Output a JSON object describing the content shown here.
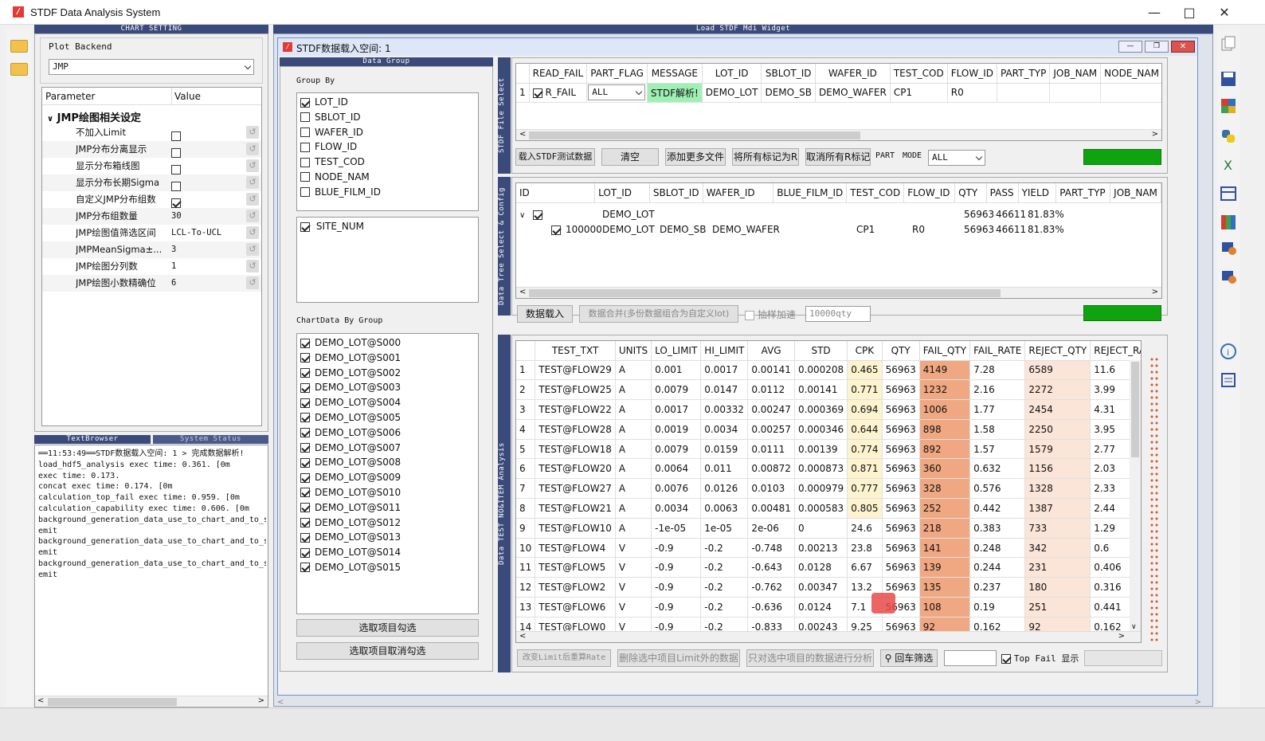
{
  "window": {
    "title": "STDF Data Analysis System",
    "app_icon": "stdf-logo-icon"
  },
  "chart_setting": {
    "header": "CHART SETTING",
    "plot_backend_label": "Plot Backend",
    "plot_backend_value": "JMP",
    "param_col": "Parameter",
    "value_col": "Value",
    "group_title": "JMP绘图相关设定",
    "params": [
      {
        "name": "不加入Limit",
        "type": "check",
        "checked": false
      },
      {
        "name": "JMP分布分离显示",
        "type": "check",
        "checked": false
      },
      {
        "name": "显示分布箱线图",
        "type": "check",
        "checked": false
      },
      {
        "name": "显示分布长期Sigma",
        "type": "check",
        "checked": false
      },
      {
        "name": "自定义JMP分布组数",
        "type": "check",
        "checked": true
      },
      {
        "name": "JMP分布组数量",
        "type": "text",
        "value": "30"
      },
      {
        "name": "JMP绘图值筛选区间",
        "type": "text",
        "value": "LCL-To-UCL"
      },
      {
        "name": "JMPMeanSigma±...",
        "type": "text",
        "value": "3"
      },
      {
        "name": "JMP绘图分列数",
        "type": "text",
        "value": "1"
      },
      {
        "name": "JMP绘图小数精确位",
        "type": "text",
        "value": "6"
      }
    ]
  },
  "log": {
    "tab1": "TextBrowser",
    "tab2": "System Status",
    "lines": [
      "══11:53:49══STDF数据载入空间: 1 > 完成数据解析!",
      "load_hdf5_analysis exec time: 0.361.  [0m",
      "exec time: 0.173.",
      "concat exec time: 0.174.  [0m",
      "calculation_top_fail exec time: 0.959.  [0m",
      "calculation_capability exec time: 0.606.  [0m",
      "background_generation_data_use_to_chart_and_to_sa",
      "emit",
      "background_generation_data_use_to_chart_and_to_sa",
      "emit",
      "background_generation_data_use_to_chart_and_to_sa",
      "emit"
    ]
  },
  "mdi": {
    "header": "Load STDF Mdi Widget",
    "sub_title": "STDF数据载入空间: 1"
  },
  "data_group": {
    "header": "Data Group",
    "group_by_label": "Group By",
    "group_by": [
      {
        "label": "LOT_ID",
        "checked": true
      },
      {
        "label": "SBLOT_ID",
        "checked": false
      },
      {
        "label": "WAFER_ID",
        "checked": false
      },
      {
        "label": "FLOW_ID",
        "checked": false
      },
      {
        "label": "TEST_COD",
        "checked": false
      },
      {
        "label": "NODE_NAM",
        "checked": false
      },
      {
        "label": "BLUE_FILM_ID",
        "checked": false
      }
    ],
    "site_num": {
      "label": "SITE_NUM",
      "checked": true
    },
    "chart_by_group_label": "ChartData By Group",
    "chart_groups": [
      "DEMO_LOT@S000",
      "DEMO_LOT@S001",
      "DEMO_LOT@S002",
      "DEMO_LOT@S003",
      "DEMO_LOT@S004",
      "DEMO_LOT@S005",
      "DEMO_LOT@S006",
      "DEMO_LOT@S007",
      "DEMO_LOT@S008",
      "DEMO_LOT@S009",
      "DEMO_LOT@S010",
      "DEMO_LOT@S011",
      "DEMO_LOT@S012",
      "DEMO_LOT@S013",
      "DEMO_LOT@S014",
      "DEMO_LOT@S015"
    ],
    "select_btn": "选取项目勾选",
    "deselect_btn": "选取项目取消勾选"
  },
  "file_select": {
    "vtab": "STDF File Select",
    "columns": [
      "",
      "READ_FAIL",
      "PART_FLAG",
      "MESSAGE",
      "LOT_ID",
      "SBLOT_ID",
      "WAFER_ID",
      "TEST_COD",
      "FLOW_ID",
      "PART_TYP",
      "JOB_NAM",
      "NODE_NAM"
    ],
    "row": {
      "idx": "1",
      "read_fail": "R_FAIL",
      "part_flag": "ALL",
      "message": "STDF解析!",
      "lot": "DEMO_LOT",
      "sblot": "DEMO_SB",
      "wafer": "DEMO_WAFER",
      "test_cod": "CP1",
      "flow": "R0"
    },
    "buttons": [
      "载入STDF测试数据",
      "清空",
      "添加更多文件",
      "将所有标记为R",
      "取消所有R标记"
    ],
    "part_label": "PART",
    "mode_label": "MODE",
    "mode_value": "ALL"
  },
  "tree_select": {
    "vtab": "Data Tree Select & Config",
    "columns": [
      "ID",
      "LOT_ID",
      "SBLOT_ID",
      "WAFER_ID",
      "BLUE_FILM_ID",
      "TEST_COD",
      "FLOW_ID",
      "QTY",
      "PASS",
      "YIELD",
      "PART_TYP",
      "JOB_NAM"
    ],
    "parent": {
      "lot": "DEMO_LOT",
      "qty": "56963",
      "pass": "46611",
      "yield": "81.83%"
    },
    "child": {
      "id": "100000",
      "lot": "DEMO_LOT",
      "sblot": "DEMO_SB",
      "wafer": "DEMO_WAFER",
      "test_cod": "CP1",
      "flow": "R0",
      "qty": "56963",
      "pass": "46611",
      "yield": "81.83%"
    },
    "load_btn": "数据载入",
    "merge_btn": "数据合并(多份数据组合为自定义lot)",
    "sample_label": "抽样加速",
    "sample_value": "10000qty"
  },
  "analysis": {
    "vtab": "Data TEST NO&ITEM Analysis",
    "columns": [
      "",
      "TEST_TXT",
      "UNITS",
      "LO_LIMIT",
      "HI_LIMIT",
      "AVG",
      "STD",
      "CPK",
      "QTY",
      "FAIL_QTY",
      "FAIL_RATE",
      "REJECT_QTY",
      "REJECT_RA"
    ],
    "rows": [
      [
        "1",
        "TEST@FLOW29",
        "A",
        "0.001",
        "0.0017",
        "0.00141",
        "0.000208",
        "0.465",
        "56963",
        "4149",
        "7.28",
        "6589",
        "11.6"
      ],
      [
        "2",
        "TEST@FLOW25",
        "A",
        "0.0079",
        "0.0147",
        "0.0112",
        "0.00141",
        "0.771",
        "56963",
        "1232",
        "2.16",
        "2272",
        "3.99"
      ],
      [
        "3",
        "TEST@FLOW22",
        "A",
        "0.0017",
        "0.00332",
        "0.00247",
        "0.000369",
        "0.694",
        "56963",
        "1006",
        "1.77",
        "2454",
        "4.31"
      ],
      [
        "4",
        "TEST@FLOW28",
        "A",
        "0.0019",
        "0.0034",
        "0.00257",
        "0.000346",
        "0.644",
        "56963",
        "898",
        "1.58",
        "2250",
        "3.95"
      ],
      [
        "5",
        "TEST@FLOW18",
        "A",
        "0.0079",
        "0.0159",
        "0.0111",
        "0.00139",
        "0.774",
        "56963",
        "892",
        "1.57",
        "1579",
        "2.77"
      ],
      [
        "6",
        "TEST@FLOW20",
        "A",
        "0.0064",
        "0.011",
        "0.00872",
        "0.000873",
        "0.871",
        "56963",
        "360",
        "0.632",
        "1156",
        "2.03"
      ],
      [
        "7",
        "TEST@FLOW27",
        "A",
        "0.0076",
        "0.0126",
        "0.0103",
        "0.000979",
        "0.777",
        "56963",
        "328",
        "0.576",
        "1328",
        "2.33"
      ],
      [
        "8",
        "TEST@FLOW21",
        "A",
        "0.0034",
        "0.0063",
        "0.00481",
        "0.000583",
        "0.805",
        "56963",
        "252",
        "0.442",
        "1387",
        "2.44"
      ],
      [
        "9",
        "TEST@FLOW10",
        "A",
        "-1e-05",
        "1e-05",
        "2e-06",
        "0",
        "24.6",
        "56963",
        "218",
        "0.383",
        "733",
        "1.29"
      ],
      [
        "10",
        "TEST@FLOW4",
        "V",
        "-0.9",
        "-0.2",
        "-0.748",
        "0.00213",
        "23.8",
        "56963",
        "141",
        "0.248",
        "342",
        "0.6"
      ],
      [
        "11",
        "TEST@FLOW5",
        "V",
        "-0.9",
        "-0.2",
        "-0.643",
        "0.0128",
        "6.67",
        "56963",
        "139",
        "0.244",
        "231",
        "0.406"
      ],
      [
        "12",
        "TEST@FLOW2",
        "V",
        "-0.9",
        "-0.2",
        "-0.762",
        "0.00347",
        "13.2",
        "56963",
        "135",
        "0.237",
        "180",
        "0.316"
      ],
      [
        "13",
        "TEST@FLOW6",
        "V",
        "-0.9",
        "-0.2",
        "-0.636",
        "0.0124",
        "7.1",
        "56963",
        "108",
        "0.19",
        "251",
        "0.441"
      ],
      [
        "14",
        "TEST@FLOW0",
        "V",
        "-0.9",
        "-0.2",
        "-0.833",
        "0.00243",
        "9.25",
        "56963",
        "92",
        "0.162",
        "92",
        "0.162"
      ]
    ],
    "buttons": {
      "recalc": "改变Limit后重算Rate",
      "delete": "删除选中项目Limit外的数据",
      "only": "只对选中项目的数据进行分析",
      "filter": "回车筛选",
      "topfail_label": "Top Fail 显示"
    }
  },
  "colors": {
    "cpk_yellow": "#fdf3cf",
    "fail_orange": "#f0a882",
    "reject_light": "#fbe4d8",
    "header_blue": "#3a4a7a",
    "green": "#0fa40f"
  }
}
